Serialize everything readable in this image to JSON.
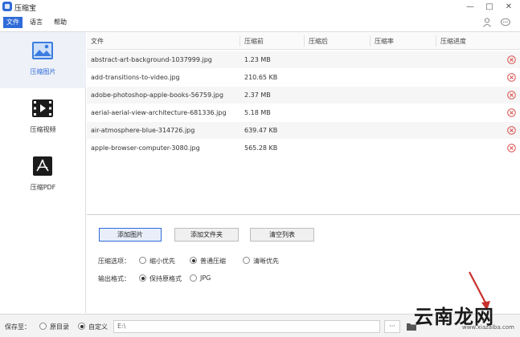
{
  "window": {
    "title": "压缩宝"
  },
  "menu": {
    "items": [
      "文件",
      "语言",
      "帮助"
    ],
    "active_index": 0
  },
  "sidebar": {
    "items": [
      {
        "label": "压缩图片",
        "icon": "image-icon",
        "active": true
      },
      {
        "label": "压缩视频",
        "icon": "video-icon",
        "active": false
      },
      {
        "label": "压缩PDF",
        "icon": "pdf-icon",
        "active": false
      }
    ]
  },
  "table": {
    "columns": [
      "文件",
      "压缩前",
      "压缩后",
      "压缩率",
      "压缩进度"
    ],
    "rows": [
      {
        "name": "abstract-art-background-1037999.jpg",
        "size": "1.23 MB"
      },
      {
        "name": "add-transitions-to-video.jpg",
        "size": "210.65 KB"
      },
      {
        "name": "adobe-photoshop-apple-books-56759.jpg",
        "size": "2.37 MB"
      },
      {
        "name": "aerial-aerial-view-architecture-681336.jpg",
        "size": "5.18 MB"
      },
      {
        "name": "air-atmosphere-blue-314726.jpg",
        "size": "639.47 KB"
      },
      {
        "name": "apple-browser-computer-3080.jpg",
        "size": "565.28 KB"
      }
    ]
  },
  "controls": {
    "add_image_label": "添加图片",
    "add_folder_label": "添加文件夹",
    "clear_list_label": "清空列表",
    "compress_option_label": "压缩选项：",
    "compress_options": [
      {
        "label": "缩小优先",
        "selected": false
      },
      {
        "label": "普通压缩",
        "selected": true
      },
      {
        "label": "清晰优先",
        "selected": false
      }
    ],
    "output_format_label": "输出格式：",
    "output_formats": [
      {
        "label": "保持原格式",
        "selected": true
      },
      {
        "label": "JPG",
        "selected": false
      }
    ]
  },
  "bottom": {
    "save_to_label": "保存至：",
    "save_options": [
      {
        "label": "原目录",
        "selected": false
      },
      {
        "label": "自定义",
        "selected": true
      }
    ],
    "path_value": "E:\\",
    "browse_label": "···"
  },
  "watermark": {
    "text": "云南龙网",
    "sub": "www.xiazaiba.com"
  },
  "colors": {
    "accent": "#2f6bd8",
    "delete": "#d9534f"
  }
}
